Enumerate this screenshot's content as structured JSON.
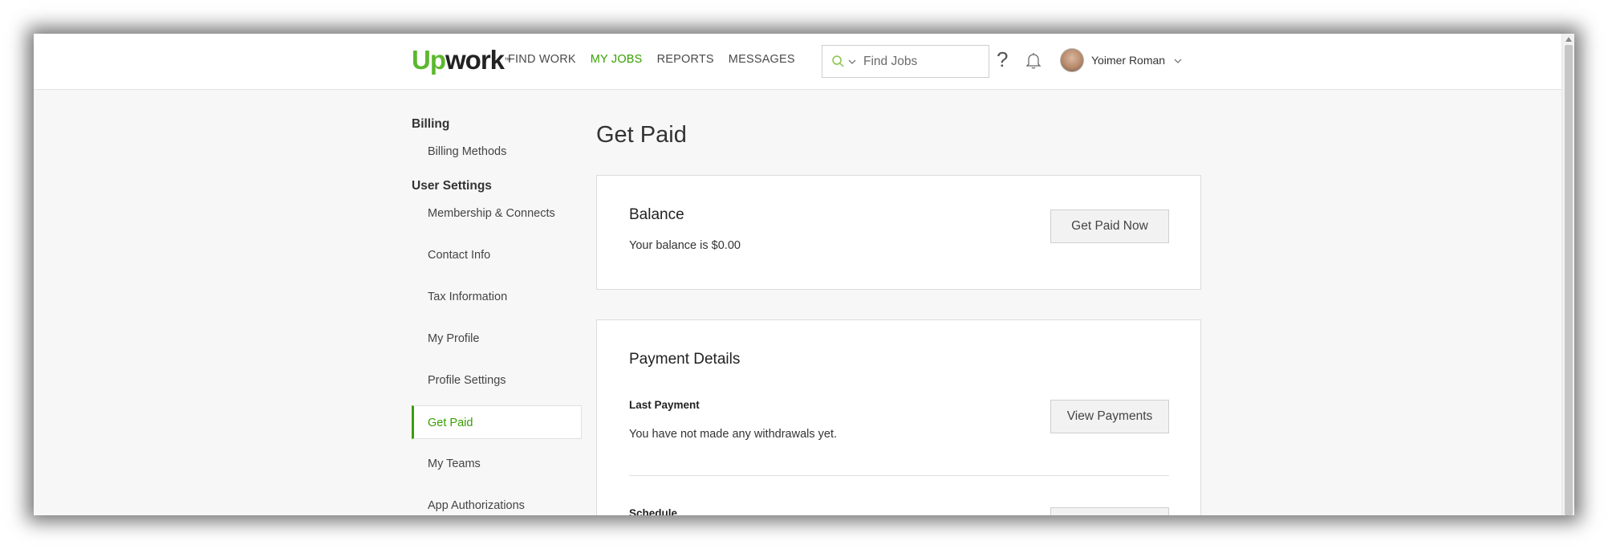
{
  "header": {
    "logo": {
      "up": "Up",
      "work": "work",
      "tm": "™"
    },
    "nav": [
      {
        "label": "FIND WORK",
        "active": false
      },
      {
        "label": "MY JOBS",
        "active": true
      },
      {
        "label": "REPORTS",
        "active": false
      },
      {
        "label": "MESSAGES",
        "active": false
      }
    ],
    "search": {
      "placeholder": "Find Jobs",
      "value": ""
    },
    "help_glyph": "?",
    "user": {
      "name": "Yoimer Roman"
    }
  },
  "sidebar": {
    "billing_heading": "Billing",
    "billing_items": [
      {
        "label": "Billing Methods"
      }
    ],
    "user_settings_heading": "User Settings",
    "user_items": [
      {
        "label": "Membership & Connects",
        "active": false
      },
      {
        "label": "Contact Info",
        "active": false
      },
      {
        "label": "Tax Information",
        "active": false
      },
      {
        "label": "My Profile",
        "active": false
      },
      {
        "label": "Profile Settings",
        "active": false
      },
      {
        "label": "Get Paid",
        "active": true
      },
      {
        "label": "My Teams",
        "active": false
      },
      {
        "label": "App Authorizations",
        "active": false
      }
    ]
  },
  "main": {
    "title": "Get Paid",
    "balance": {
      "title": "Balance",
      "text_prefix": "Your balance is ",
      "amount": "$0.00",
      "button": "Get Paid Now"
    },
    "payment_details": {
      "title": "Payment Details",
      "last_payment_heading": "Last Payment",
      "last_payment_text": "You have not made any withdrawals yet.",
      "view_payments_button": "View Payments",
      "schedule_heading": "Schedule"
    }
  },
  "colors": {
    "brand_green": "#37a000",
    "logo_green": "#5cb82f",
    "page_bg": "#f7f7f7",
    "card_border": "#dcdcdc"
  },
  "icons": [
    "search-icon",
    "chevron-down-icon",
    "help-icon",
    "bell-icon",
    "avatar",
    "scroll-up-arrow-icon"
  ]
}
